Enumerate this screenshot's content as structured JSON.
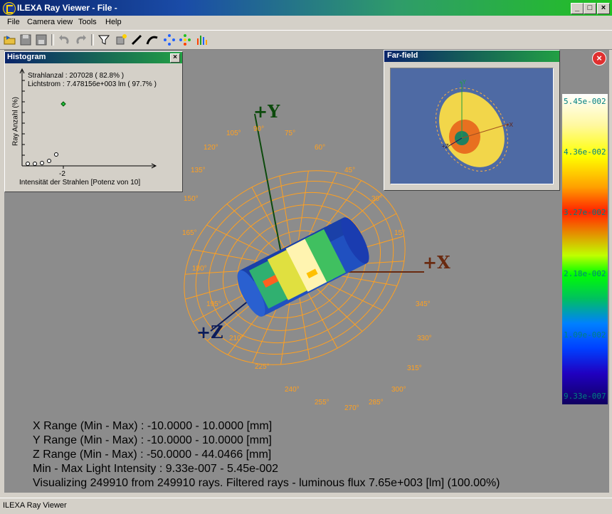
{
  "window": {
    "title": "ILEXA Ray Viewer - File -"
  },
  "menu": [
    "File",
    "Camera view",
    "Tools",
    "Help"
  ],
  "histogram": {
    "title": "Histogram",
    "line1": "Strahlanzal : 207028 ( 82.8% )",
    "line2": "Lichtstrom : 7.478156e+003 lm ( 97.7% )",
    "ylabel": "Ray Anzahl (%)",
    "xtick": "-2",
    "xlabel": "Intensität der Strahlen [Potenz von 10]"
  },
  "farfield": {
    "title": "Far-field"
  },
  "axes": {
    "x": "+X",
    "y": "+Y",
    "z": "+Z"
  },
  "angles": [
    "90°",
    "75°",
    "60°",
    "45°",
    "30°",
    "15°",
    "345°",
    "330°",
    "315°",
    "300°",
    "285°",
    "270°",
    "255°",
    "240°",
    "225°",
    "210°",
    "195°",
    "180°",
    "165°",
    "150°",
    "135°",
    "120°",
    "105°"
  ],
  "colorbar": {
    "labels": [
      "5.45e-002",
      "4.36e-002",
      "3.27e-002",
      "2.18e-002",
      "1.09e-002",
      "9.33e-007"
    ],
    "colors": {
      "teal": "#008080"
    }
  },
  "info": {
    "x_range": "X Range (Min - Max) : -10.0000 - 10.0000 [mm]",
    "y_range": "Y Range (Min - Max) : -10.0000 - 10.0000 [mm]",
    "z_range": "Z Range (Min - Max) : -50.0000 - 44.0466 [mm]",
    "intensity": "Min - Max Light Intensity : 9.33e-007 - 5.45e-002",
    "visualizing": "Visualizing 249910 from 249910 rays. Filtered rays - luminous flux 7.65e+003 [lm] (100.00%)"
  },
  "status": {
    "text": "ILEXA Ray Viewer"
  }
}
